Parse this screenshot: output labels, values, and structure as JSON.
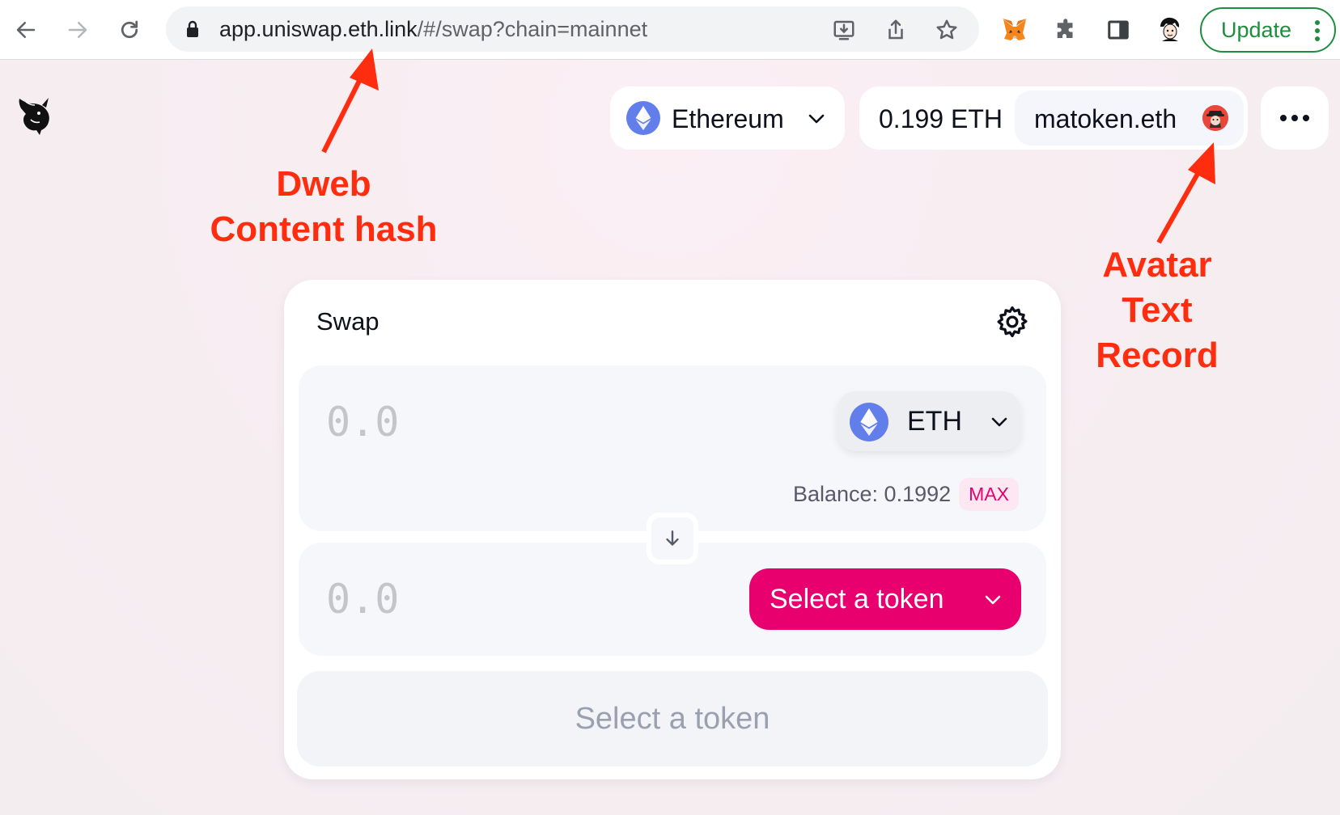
{
  "browser": {
    "url_host": "app.uniswap.eth.link",
    "url_path": "/#/swap?chain=mainnet",
    "update_label": "Update"
  },
  "header": {
    "network": "Ethereum",
    "balance": "0.199 ETH",
    "ens_name": "matoken.eth"
  },
  "swap": {
    "title": "Swap",
    "input_amount": "0.0",
    "input_token": "ETH",
    "balance_label": "Balance: 0.1992",
    "max_label": "MAX",
    "output_amount": "0.0",
    "select_token_label": "Select a token",
    "action_label": "Select a token"
  },
  "annotations": {
    "dweb_line1": "Dweb",
    "dweb_line2": "Content hash",
    "avatar_line1": "Avatar",
    "avatar_line2": "Text",
    "avatar_line3": "Record"
  },
  "colors": {
    "accent_pink": "#e8006f",
    "annotation_red": "#ff2d10",
    "eth_blue": "#627eea",
    "update_green": "#1e8e3e"
  },
  "icons": [
    "back-arrow-icon",
    "forward-arrow-icon",
    "reload-icon",
    "lock-icon",
    "install-icon",
    "share-icon",
    "star-icon",
    "metamask-fox-icon",
    "puzzle-extension-icon",
    "sidepanel-icon",
    "profile-avatar-icon",
    "kebab-menu-icon",
    "uniswap-unicorn-icon",
    "ethereum-icon",
    "chevron-down-icon",
    "gear-icon",
    "arrow-down-icon",
    "more-dots-icon"
  ]
}
